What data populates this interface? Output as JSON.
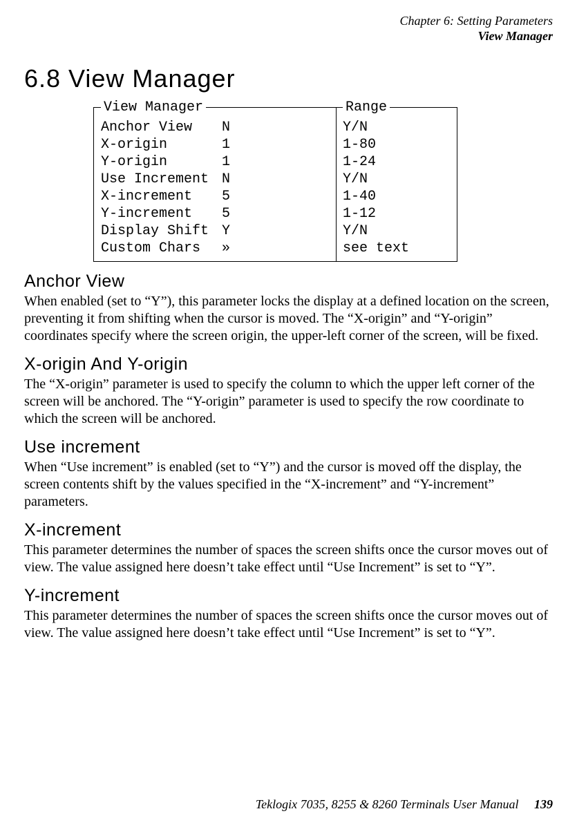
{
  "header": {
    "chapter": "Chapter 6: Setting Parameters",
    "section": "View Manager"
  },
  "section_title": "6.8  View Manager",
  "table": {
    "left_legend": "View Manager",
    "right_legend": "Range",
    "rows": [
      {
        "label": "Anchor View",
        "value": "N",
        "range": "Y/N"
      },
      {
        "label": "X-origin",
        "value": "1",
        "range": "1-80"
      },
      {
        "label": "Y-origin",
        "value": "1",
        "range": "1-24"
      },
      {
        "label": "Use Increment",
        "value": "N",
        "range": "Y/N"
      },
      {
        "label": "X-increment",
        "value": "5",
        "range": "1-40"
      },
      {
        "label": "Y-increment",
        "value": "5",
        "range": "1-12"
      },
      {
        "label": "Display Shift",
        "value": "Y",
        "range": "Y/N"
      },
      {
        "label": "Custom Chars",
        "value": "»",
        "range": "see text"
      }
    ]
  },
  "sections": [
    {
      "heading": "Anchor View",
      "body": "When enabled (set to “Y”), this parameter locks the display at a defined location on the screen, preventing it from shifting when the cursor is moved. The “X-origin” and “Y-origin” coordinates specify where the screen origin, the upper-left corner of the screen, will be fixed."
    },
    {
      "heading": "X-origin And Y-origin",
      "body": "The “X-origin” parameter is used to specify the column to which the upper left corner of the screen will be anchored. The “Y-origin” parameter is used to specify the row coordinate to which the screen will be anchored."
    },
    {
      "heading": "Use increment",
      "body": "When “Use increment” is enabled (set to “Y”) and the cursor is moved off the display, the screen contents shift by the values specified in the “X-increment” and “Y-increment” parameters."
    },
    {
      "heading": "X-increment",
      "body": "This parameter determines the number of spaces the screen shifts once the cursor moves out of view. The value assigned here doesn’t take effect until “Use Increment” is set to “Y”."
    },
    {
      "heading": "Y-increment",
      "body": "This parameter determines the number of spaces the screen shifts once the cursor moves out of view. The value assigned here doesn’t take effect until “Use Increment” is set to “Y”."
    }
  ],
  "footer": {
    "text": "Teklogix 7035, 8255 & 8260 Terminals User Manual",
    "page": "139"
  }
}
